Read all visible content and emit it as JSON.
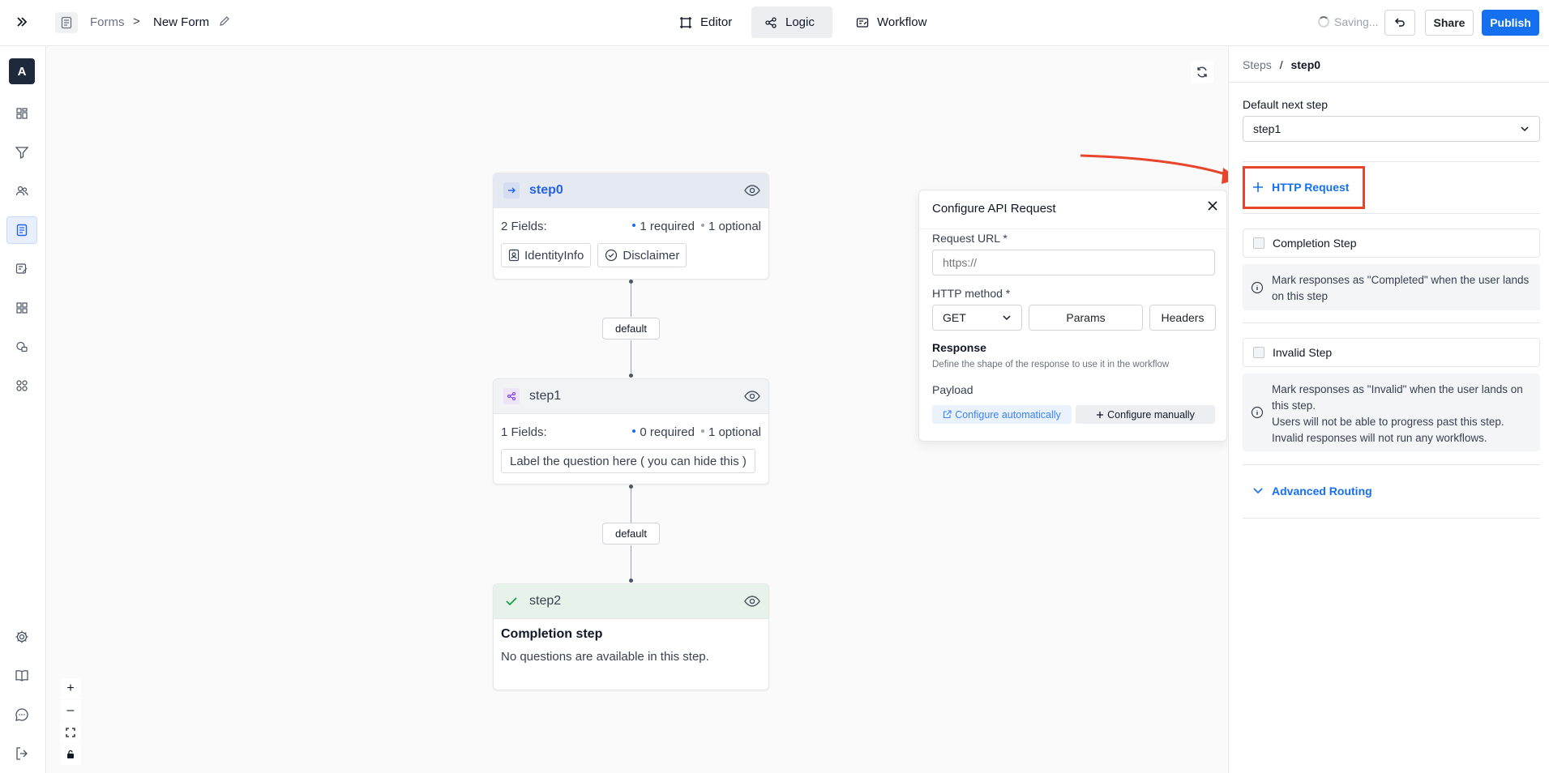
{
  "header": {
    "breadcrumb_forms": "Forms",
    "breadcrumb_sep": ">",
    "breadcrumb_current": "New Form",
    "tabs": [
      {
        "label": "Editor",
        "icon": "frame-icon"
      },
      {
        "label": "Logic",
        "icon": "logic-icon",
        "active": true
      },
      {
        "label": "Workflow",
        "icon": "workflow-icon"
      }
    ],
    "status": "Saving...",
    "share_label": "Share",
    "publish_label": "Publish"
  },
  "sidebar": {
    "avatar_letter": "A",
    "items": [
      "dashboard-icon",
      "filter-icon",
      "users-icon",
      "forms-icon",
      "edit-form-icon",
      "grid-icon",
      "shapes-icon",
      "apps-icon"
    ],
    "active_item": "forms-icon",
    "bottom_items": [
      "settings-icon",
      "book-icon",
      "chat-icon",
      "logout-icon"
    ]
  },
  "canvas": {
    "nodes": [
      {
        "name": "step0",
        "fields_label": "2 Fields:",
        "required": "1 required",
        "optional": "1 optional",
        "chips": [
          "IdentityInfo",
          "Disclaimer"
        ]
      },
      {
        "name": "step1",
        "fields_label": "1 Fields:",
        "required": "0 required",
        "optional": "1 optional",
        "chips": [
          "Label the question here ( you can hide this )"
        ]
      },
      {
        "name": "step2",
        "title": "Completion step",
        "text": "No questions are available in this step."
      }
    ],
    "edges": [
      "default",
      "default"
    ],
    "zoom_controls": [
      "+",
      "–"
    ]
  },
  "api_popover": {
    "title": "Configure API Request",
    "url_label": "Request URL *",
    "url_placeholder": "https://",
    "method_label": "HTTP method *",
    "method_value": "GET",
    "params_label": "Params",
    "headers_label": "Headers",
    "response_title": "Response",
    "response_desc": "Define the shape of the response to use it in the workflow",
    "payload_label": "Payload",
    "configure_auto": "Configure automatically",
    "configure_manual": "Configure manually"
  },
  "right_panel": {
    "crumb_steps": "Steps",
    "crumb_sep": "/",
    "crumb_current": "step0",
    "default_next_label": "Default next step",
    "default_next_value": "step1",
    "http_request_label": "HTTP Request",
    "completion_label": "Completion Step",
    "completion_info": "Mark responses as \"Completed\" when the user lands on this step",
    "invalid_label": "Invalid Step",
    "invalid_info_1": "Mark responses as \"Invalid\" when the user lands on this step.",
    "invalid_info_2": "Users will not be able to progress past this step.",
    "invalid_info_3": "Invalid responses will not run any workflows.",
    "advanced_label": "Advanced Routing"
  },
  "colors": {
    "accent": "#1570ef",
    "annotation": "#e8452c",
    "step0_header": "#e4e9f2",
    "step2_header": "#e7f3ea"
  }
}
